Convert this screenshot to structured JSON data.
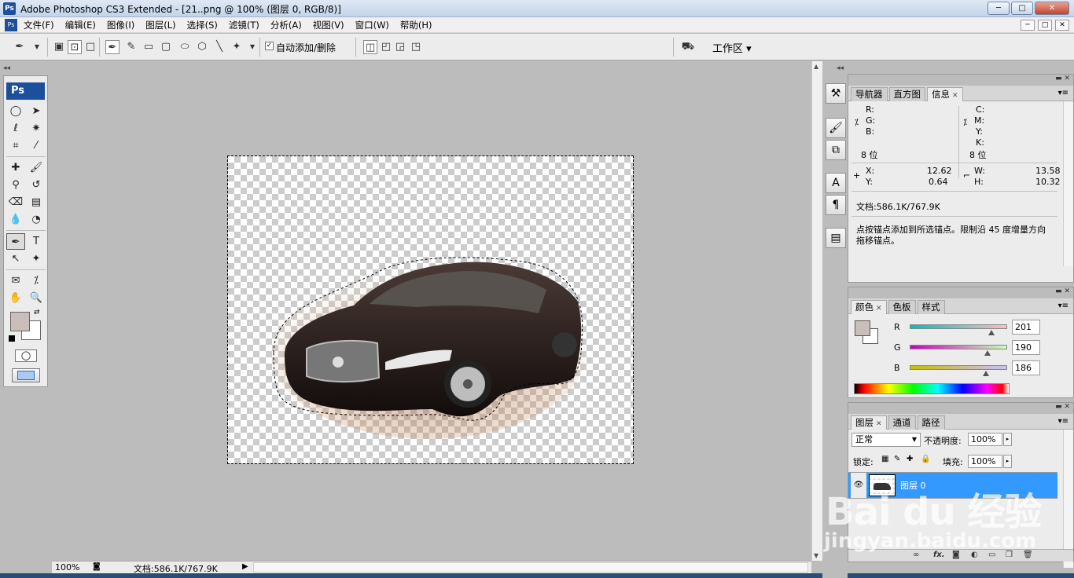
{
  "window": {
    "title": "Adobe Photoshop CS3 Extended - [21..png @ 100% (图层 0, RGB/8)]",
    "app_icon": "Ps",
    "minimize": "─",
    "maximize": "□",
    "close": "✕"
  },
  "menu": {
    "items": [
      "文件(F)",
      "编辑(E)",
      "图像(I)",
      "图层(L)",
      "选择(S)",
      "滤镜(T)",
      "分析(A)",
      "视图(V)",
      "窗口(W)",
      "帮助(H)"
    ],
    "doc_min": "─",
    "doc_restore": "□",
    "doc_close": "✕"
  },
  "options": {
    "tool_icon": "pen-tool-icon",
    "auto_add_delete_label": "自动添加/删除",
    "auto_add_delete_checked": true,
    "workspace_label": "工作区 ▾"
  },
  "toolbox": {
    "header": "Ps",
    "foreground_color": "#c9beba",
    "background_color": "#ffffff"
  },
  "canvas": {
    "background_color": "#bcbcbc"
  },
  "status": {
    "zoom": "100%",
    "doc_info": "文档:586.1K/767.9K"
  },
  "info_panel": {
    "tabs": [
      "导航器",
      "直方图",
      "信息"
    ],
    "active_tab": "信息",
    "rgb_labels": [
      "R:",
      "G:",
      "B:"
    ],
    "cmyk_labels": [
      "C:",
      "M:",
      "Y:",
      "K:"
    ],
    "bit_depth_left": "8 位",
    "bit_depth_right": "8 位",
    "x_label": "X:",
    "x_value": "12.62",
    "y_label": "Y:",
    "y_value": "0.64",
    "w_label": "W:",
    "w_value": "13.58",
    "h_label": "H:",
    "h_value": "10.32",
    "doc_info": "文档:586.1K/767.9K",
    "hint_line1": "点按锚点添加到所选锚点。限制沿 45 度增量方向",
    "hint_line2": "拖移锚点。"
  },
  "color_panel": {
    "tabs": [
      "颜色",
      "色板",
      "样式"
    ],
    "active_tab": "颜色",
    "channels": [
      {
        "label": "R",
        "value": "201"
      },
      {
        "label": "G",
        "value": "190"
      },
      {
        "label": "B",
        "value": "186"
      }
    ],
    "swatch": "#c9beba"
  },
  "layers_panel": {
    "tabs": [
      "图层",
      "通道",
      "路径"
    ],
    "active_tab": "图层",
    "blend_mode": "正常",
    "opacity_label": "不透明度:",
    "opacity_value": "100%",
    "lock_label": "锁定:",
    "fill_label": "填充:",
    "fill_value": "100%",
    "layer_name": "图层 0"
  },
  "watermark": {
    "line1": "Bai du 经验",
    "line2": "jingyan.baidu.com"
  }
}
